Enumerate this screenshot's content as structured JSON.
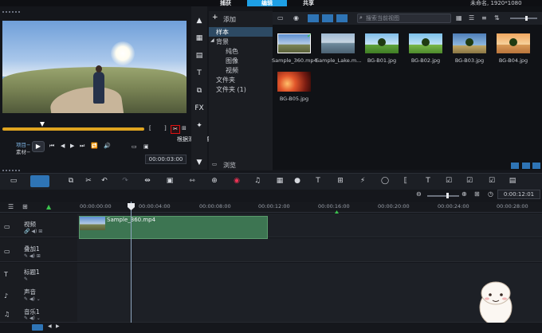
{
  "window": {
    "tabs": [
      {
        "label": "捕获",
        "active": false
      },
      {
        "label": "编辑",
        "active": true
      },
      {
        "label": "共享",
        "active": false
      }
    ],
    "title_right": "未命名, 1920*1080"
  },
  "player": {
    "project_label": "项目−",
    "clip_label": "素材−",
    "timecode": "00:00:03:00",
    "tooltip": "根据滑轨位置分割素材 (S)",
    "play_symbol": "▶",
    "brackets": [
      "[",
      "]"
    ]
  },
  "library": {
    "add_label": "添加",
    "tree": [
      {
        "label": "样本",
        "selected": true
      },
      {
        "label": "背景",
        "selected": false
      },
      {
        "label": "纯色",
        "selected": false
      },
      {
        "label": "图像",
        "selected": false
      },
      {
        "label": "视频",
        "selected": false
      },
      {
        "label": "文件夹",
        "selected": false
      },
      {
        "label": "文件夹 (1)",
        "selected": false
      }
    ],
    "browse_label": "浏览",
    "search_placeholder": "搜索当前视图",
    "thumbnails": [
      {
        "caption": "Sample_360.mp4",
        "theme": "t-sample"
      },
      {
        "caption": "Sample_Lake.m...",
        "theme": "t-lake"
      },
      {
        "caption": "BG-B01.jpg",
        "theme": "t-b01"
      },
      {
        "caption": "BG-B02.jpg",
        "theme": "t-b02"
      },
      {
        "caption": "BG-B03.jpg",
        "theme": "t-b03"
      },
      {
        "caption": "BG-B04.jpg",
        "theme": "t-b04"
      },
      {
        "caption": "BG-B05.jpg",
        "theme": "t-b05"
      }
    ]
  },
  "timeline": {
    "timecode": "0:00:12:01",
    "ruler": [
      "00:00:00:00",
      "00:00:04:00",
      "00:00:08:00",
      "00:00:12:00",
      "00:00:16:00",
      "00:00:20:00",
      "00:00:24:00",
      "00:00:28:00"
    ],
    "tracks": [
      {
        "name": "视频",
        "icon": "video-track-icon"
      },
      {
        "name": "叠加1",
        "icon": "overlay-track-icon"
      },
      {
        "name": "标题1",
        "icon": "title-track-icon"
      },
      {
        "name": "声音",
        "icon": "voice-track-icon"
      },
      {
        "name": "音乐1",
        "icon": "music-track-icon"
      }
    ],
    "clip": {
      "label": "Sample_360.mp4"
    }
  },
  "tool_icons": [
    "storyboard-view-icon",
    "timeline-view-icon",
    "multi-trim-icon",
    "fx-icon",
    "undo-icon",
    "redo-icon"
  ],
  "colors": {
    "accent": "#1ea0e6",
    "clip_green": "#3d7552",
    "scrub_yellow": "#e0a520",
    "split_highlight": "#dd1111"
  }
}
